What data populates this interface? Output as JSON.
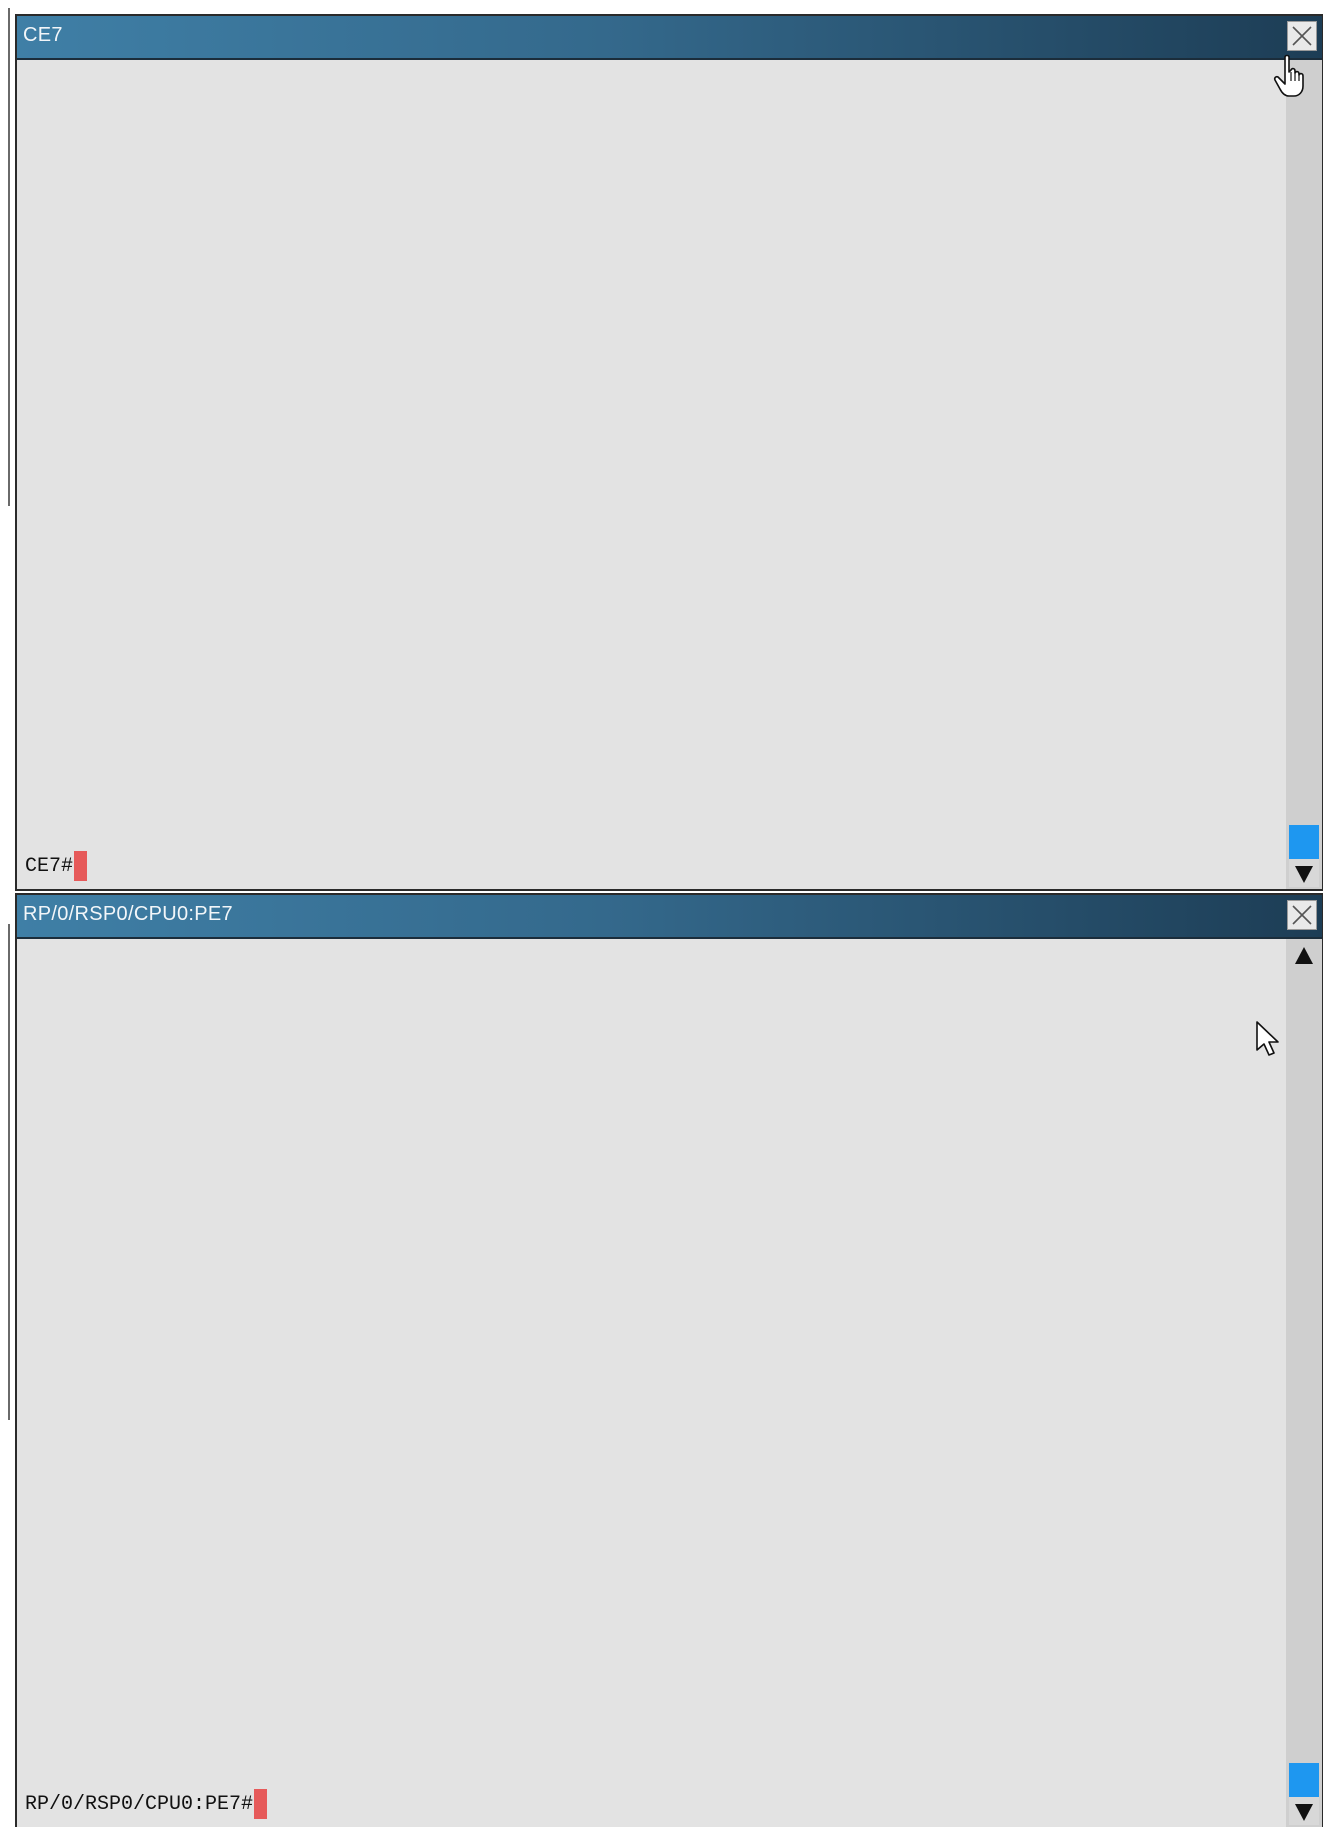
{
  "windows": [
    {
      "title": "CE7",
      "prompt": "CE7#",
      "close_label": "close",
      "has_up_arrow": false
    },
    {
      "title": "RP/0/RSP0/CPU0:PE7",
      "prompt": "RP/0/RSP0/CPU0:PE7#",
      "close_label": "close",
      "has_up_arrow": true
    }
  ],
  "colors": {
    "title_bar_start": "#3f7fa6",
    "title_bar_end": "#1d3d55",
    "terminal_bg": "#e3e3e3",
    "cursor": "#e65a5a",
    "scroll_thumb": "#1e97f0"
  },
  "icons": {
    "close": "close-x-icon",
    "scroll_up": "triangle-up-icon",
    "scroll_down": "triangle-down-icon",
    "pointer_hand": "hand-pointer-icon",
    "pointer_arrow": "arrow-pointer-icon"
  }
}
